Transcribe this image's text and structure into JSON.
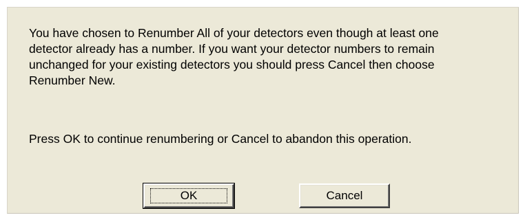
{
  "dialog": {
    "message_lines": "You have chosen to Renumber All of your detectors even though at least one\ndetector already has a number.  If you want your detector numbers to remain\nunchanged for your existing detectors you should press Cancel then choose\nRenumber New.",
    "prompt": "Press OK to continue renumbering or Cancel to abandon this operation.",
    "ok_label": "OK",
    "cancel_label": "Cancel"
  },
  "colors": {
    "dialog_background": "#ece9d8",
    "text": "#000000"
  }
}
